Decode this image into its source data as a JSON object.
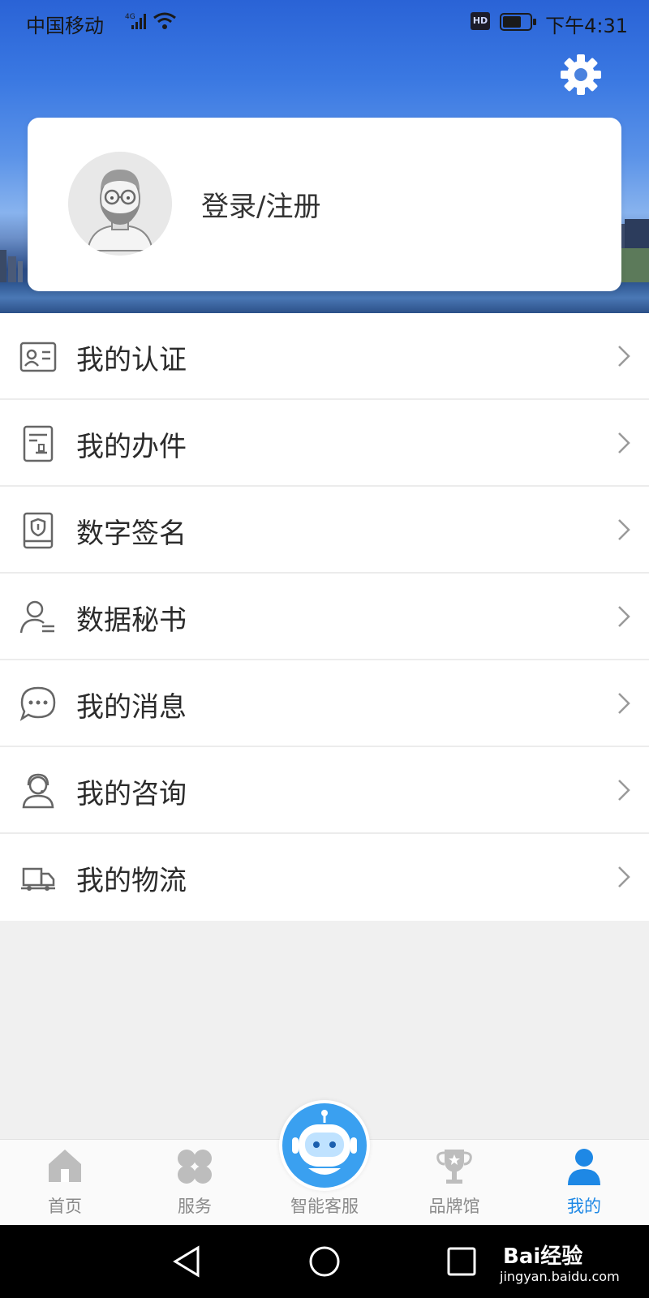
{
  "status_bar": {
    "carrier": "中国移动",
    "network": "4G",
    "hd": "HD",
    "time": "下午4:31"
  },
  "header": {
    "settings_icon": "gear-icon"
  },
  "profile": {
    "login_label": "登录/注册",
    "avatar_icon": "default-avatar-icon"
  },
  "menu": {
    "items": [
      {
        "label": "我的认证",
        "icon": "id-card-icon"
      },
      {
        "label": "我的办件",
        "icon": "document-stamp-icon"
      },
      {
        "label": "数字签名",
        "icon": "shield-book-icon"
      },
      {
        "label": "数据秘书",
        "icon": "user-list-icon"
      },
      {
        "label": "我的消息",
        "icon": "chat-bubble-icon"
      },
      {
        "label": "我的咨询",
        "icon": "headset-user-icon"
      },
      {
        "label": "我的物流",
        "icon": "truck-icon"
      }
    ]
  },
  "tabbar": {
    "tabs": [
      {
        "label": "首页",
        "icon": "home-icon",
        "active": false
      },
      {
        "label": "服务",
        "icon": "clover-icon",
        "active": false
      },
      {
        "label": "智能客服",
        "icon": "robot-icon",
        "active": false
      },
      {
        "label": "品牌馆",
        "icon": "trophy-icon",
        "active": false
      },
      {
        "label": "我的",
        "icon": "person-icon",
        "active": true
      }
    ],
    "active_color": "#1e88e5",
    "inactive_color": "#8a8a8a"
  },
  "watermark": {
    "brand": "Bai经验",
    "url": "jingyan.baidu.com"
  }
}
